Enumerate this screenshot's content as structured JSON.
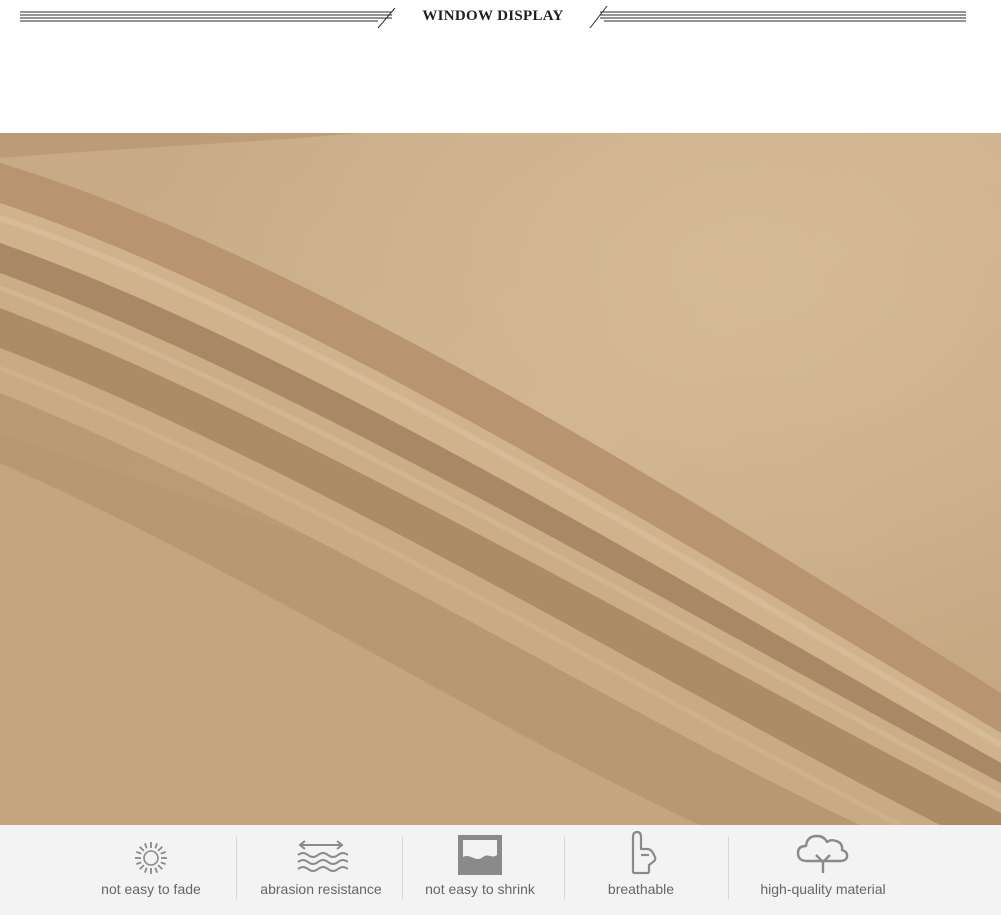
{
  "header": {
    "title": "WINDOW DISPLAY"
  },
  "photo": {
    "subject": "khaki twill fabric folds",
    "base_color": "#c9a983"
  },
  "features": [
    {
      "label": "not easy to fade",
      "icon": "sun-icon"
    },
    {
      "label": "abrasion resistance",
      "icon": "waves-arrows-icon"
    },
    {
      "label": "not easy to shrink",
      "icon": "shrink-box-icon"
    },
    {
      "label": "breathable",
      "icon": "hand-icon"
    },
    {
      "label": "high-quality material",
      "icon": "tree-icon"
    }
  ],
  "colors": {
    "icon": "#8a8a8a",
    "label": "#666666",
    "bar_background": "#f3f3f3"
  }
}
